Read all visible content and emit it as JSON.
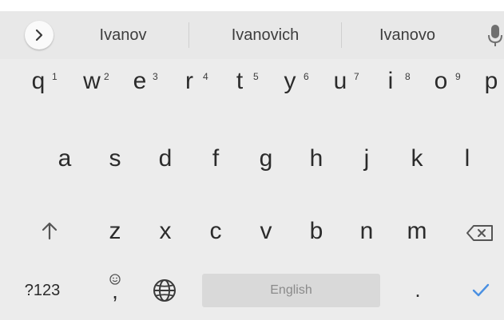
{
  "keyboard": {
    "suggestions": [
      "Ivanov",
      "Ivanovich",
      "Ivanovo"
    ],
    "row1": [
      {
        "label": "q",
        "hint": "1"
      },
      {
        "label": "w",
        "hint": "2"
      },
      {
        "label": "e",
        "hint": "3"
      },
      {
        "label": "r",
        "hint": "4"
      },
      {
        "label": "t",
        "hint": "5"
      },
      {
        "label": "y",
        "hint": "6"
      },
      {
        "label": "u",
        "hint": "7"
      },
      {
        "label": "i",
        "hint": "8"
      },
      {
        "label": "o",
        "hint": "9"
      },
      {
        "label": "p",
        "hint": ""
      }
    ],
    "row2": [
      "a",
      "s",
      "d",
      "f",
      "g",
      "h",
      "j",
      "k",
      "l"
    ],
    "row3": [
      "z",
      "x",
      "c",
      "v",
      "b",
      "n",
      "m"
    ],
    "bottom": {
      "symbols_label": "?123",
      "comma_label": ",",
      "space_label": "English",
      "period_label": "."
    },
    "icons": {
      "expand": "chevron-right-icon",
      "mic": "microphone-icon",
      "shift": "shift-arrow-icon",
      "backspace": "backspace-icon",
      "emoji": "emoji-icon",
      "language": "globe-icon",
      "enter": "checkmark-icon"
    },
    "colors": {
      "background": "#ececec",
      "suggestion_bar": "#e8e8e8",
      "enter_accent": "#4a90e2",
      "key_text": "#2b2b2b"
    }
  }
}
